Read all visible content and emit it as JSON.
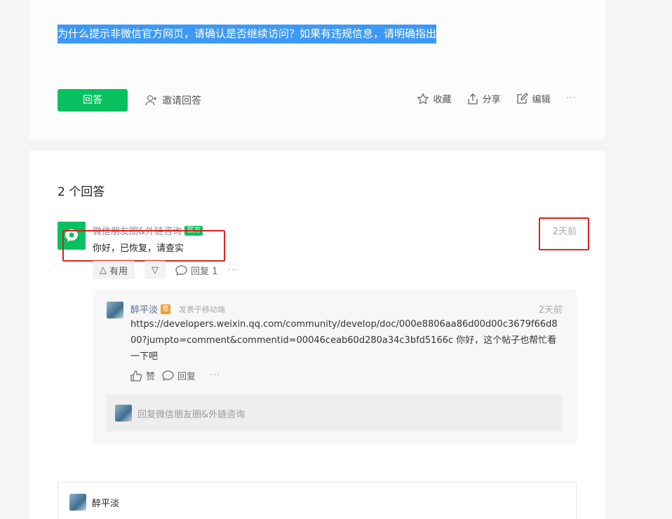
{
  "question": {
    "title": "为什么提示非微信官方网页，请确认是否继续访问？如果有违规信息，请明确指出",
    "answer_button": "回答",
    "invite_label": "邀请回答",
    "actions": {
      "favorite": "收藏",
      "share": "分享",
      "edit": "编辑",
      "more": "···"
    }
  },
  "answers": {
    "count_label": "2 个回答",
    "first": {
      "author": "微信朋友圈&外链咨询",
      "badge": "官方",
      "text": "你好，已恢复，请查实",
      "time": "2天前",
      "useful_label": "有用",
      "reply_label": "回复 1",
      "more": "···"
    },
    "reply": {
      "author": "醉平淡",
      "badge": "悠",
      "source": "发表于移动端",
      "time": "2天前",
      "text": "https://developers.weixin.qq.com/community/develop/doc/000e8806aa86d00d00c3679f66d800?jumpto=comment&commentid=00046ceab60d280a34c3bfd5166c 你好，这个帖子也帮忙看一下吧",
      "like_label": "赞",
      "reply_label": "回复",
      "more": "···",
      "reply_placeholder": "回复微信朋友圈&外链咨询"
    }
  },
  "composer": {
    "user": "醉平淡"
  },
  "colors": {
    "brand_green": "#07c160",
    "highlight_blue": "#3d99f5",
    "annotation_red": "#e02020",
    "link_blue": "#576b95"
  }
}
